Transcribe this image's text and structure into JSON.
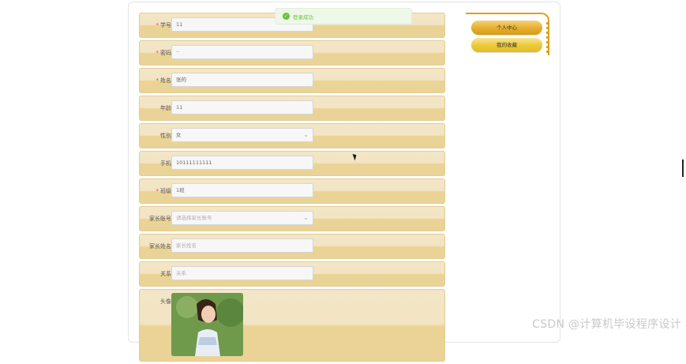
{
  "toast": {
    "icon": "check-circle-icon",
    "message": "登录成功"
  },
  "sidebar": {
    "items": [
      {
        "label": "个人中心",
        "active": true
      },
      {
        "label": "我的收藏",
        "active": false
      }
    ]
  },
  "form": {
    "student_no": {
      "label": "学号",
      "required": true,
      "value": "11"
    },
    "password": {
      "label": "密码",
      "required": true,
      "value": "··"
    },
    "name": {
      "label": "姓名",
      "required": true,
      "value": "张的"
    },
    "age": {
      "label": "年龄",
      "required": false,
      "value": "11"
    },
    "gender": {
      "label": "性别",
      "required": false,
      "value": "女"
    },
    "phone": {
      "label": "手机",
      "required": false,
      "value": "10111111111"
    },
    "class": {
      "label": "班级",
      "required": true,
      "value": "1班"
    },
    "parent_account": {
      "label": "家长账号",
      "required": false,
      "placeholder": "请选择家长账号"
    },
    "parent_name": {
      "label": "家长姓名",
      "required": false,
      "placeholder": "家长姓名"
    },
    "relation": {
      "label": "关系",
      "required": false,
      "placeholder": "关系"
    },
    "avatar": {
      "label": "头像"
    }
  },
  "watermark": "CSDN @计算机毕设程序设计",
  "colors": {
    "accent": "#d9a21b",
    "row_top": "#f3e6c6",
    "row_bottom": "#ead394",
    "success": "#67c23a",
    "required": "#e0393e"
  }
}
